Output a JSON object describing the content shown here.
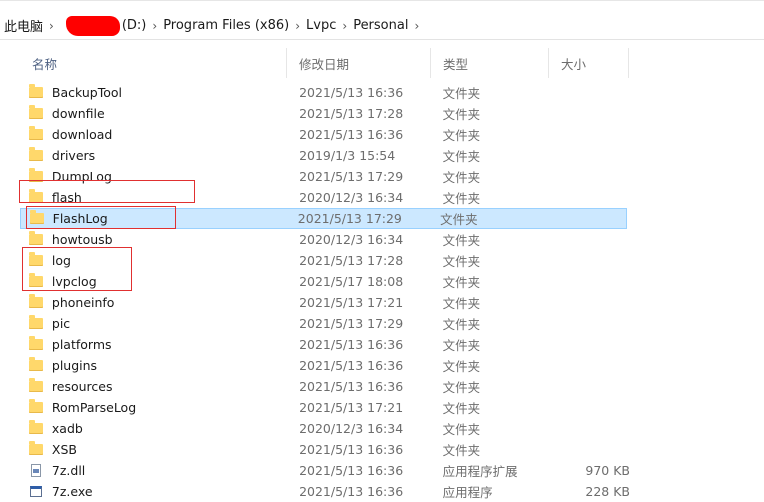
{
  "breadcrumb": {
    "items": [
      "此电脑",
      "(D:)",
      "Program Files (x86)",
      "Lvpc",
      "Personal"
    ],
    "separator": "›"
  },
  "header": {
    "name": "名称",
    "date": "修改日期",
    "type": "类型",
    "size": "大小",
    "sort_indicator": "^"
  },
  "files": [
    {
      "name": "BackupTool",
      "date": "2021/5/13 16:36",
      "type": "文件夹",
      "size": "",
      "icon": "folder-icon"
    },
    {
      "name": "downfile",
      "date": "2021/5/13 17:28",
      "type": "文件夹",
      "size": "",
      "icon": "folder-icon"
    },
    {
      "name": "download",
      "date": "2021/5/13 16:36",
      "type": "文件夹",
      "size": "",
      "icon": "folder-icon"
    },
    {
      "name": "drivers",
      "date": "2019/1/3 15:54",
      "type": "文件夹",
      "size": "",
      "icon": "folder-icon"
    },
    {
      "name": "DumpLog",
      "date": "2021/5/13 17:29",
      "type": "文件夹",
      "size": "",
      "icon": "folder-icon"
    },
    {
      "name": "flash",
      "date": "2020/12/3 16:34",
      "type": "文件夹",
      "size": "",
      "icon": "folder-icon"
    },
    {
      "name": "FlashLog",
      "date": "2021/5/13 17:29",
      "type": "文件夹",
      "size": "",
      "icon": "folder-icon",
      "selected": true
    },
    {
      "name": "howtousb",
      "date": "2020/12/3 16:34",
      "type": "文件夹",
      "size": "",
      "icon": "folder-icon"
    },
    {
      "name": "log",
      "date": "2021/5/13 17:28",
      "type": "文件夹",
      "size": "",
      "icon": "folder-icon"
    },
    {
      "name": "lvpclog",
      "date": "2021/5/17 18:08",
      "type": "文件夹",
      "size": "",
      "icon": "folder-icon"
    },
    {
      "name": "phoneinfo",
      "date": "2021/5/13 17:21",
      "type": "文件夹",
      "size": "",
      "icon": "folder-icon"
    },
    {
      "name": "pic",
      "date": "2021/5/13 17:29",
      "type": "文件夹",
      "size": "",
      "icon": "folder-icon"
    },
    {
      "name": "platforms",
      "date": "2021/5/13 16:36",
      "type": "文件夹",
      "size": "",
      "icon": "folder-icon"
    },
    {
      "name": "plugins",
      "date": "2021/5/13 16:36",
      "type": "文件夹",
      "size": "",
      "icon": "folder-icon"
    },
    {
      "name": "resources",
      "date": "2021/5/13 16:36",
      "type": "文件夹",
      "size": "",
      "icon": "folder-icon"
    },
    {
      "name": "RomParseLog",
      "date": "2021/5/13 17:21",
      "type": "文件夹",
      "size": "",
      "icon": "folder-icon"
    },
    {
      "name": "xadb",
      "date": "2020/12/3 16:34",
      "type": "文件夹",
      "size": "",
      "icon": "folder-icon"
    },
    {
      "name": "XSB",
      "date": "2021/5/13 16:36",
      "type": "文件夹",
      "size": "",
      "icon": "folder-icon"
    },
    {
      "name": "7z.dll",
      "date": "2021/5/13 16:36",
      "type": "应用程序扩展",
      "size": "970 KB",
      "icon": "dll-file-icon"
    },
    {
      "name": "7z.exe",
      "date": "2021/5/13 16:36",
      "type": "应用程序",
      "size": "228 KB",
      "icon": "exe-file-icon"
    }
  ],
  "colors": {
    "selection_bg": "#cce8ff",
    "selection_border": "#99d1ff",
    "annotation_red": "#e03030",
    "folder_yellow": "#ffd86b"
  }
}
